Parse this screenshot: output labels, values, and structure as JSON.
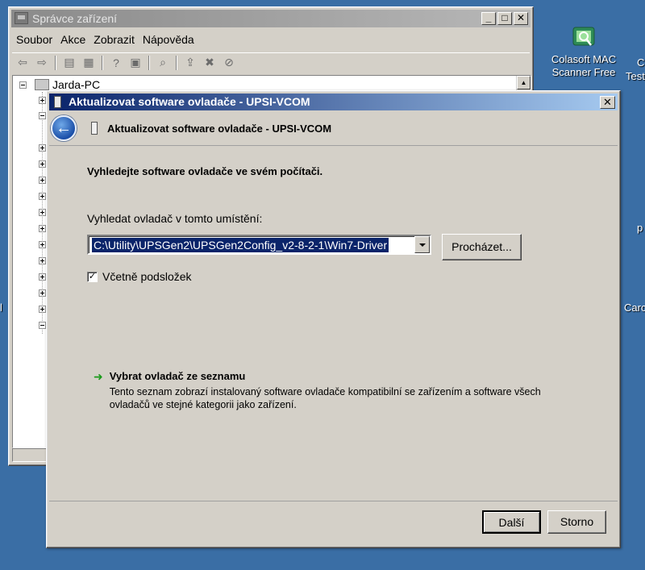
{
  "desktop": {
    "icons": [
      {
        "label_line1": "Colasoft MAC",
        "label_line2": "Scanner Free"
      }
    ],
    "edge_texts": [
      "C",
      "Test",
      "p",
      "Carc",
      "l"
    ]
  },
  "device_manager": {
    "title": "Správce zařízení",
    "menu": [
      "Soubor",
      "Akce",
      "Zobrazit",
      "Nápověda"
    ],
    "tree_root": "Jarda-PC",
    "caption_buttons": {
      "minimize": "_",
      "maximize": "□",
      "close": "✕"
    }
  },
  "wizard": {
    "window_title": "Aktualizovat software ovladače - UPSI-VCOM",
    "header_title": "Aktualizovat software ovladače - UPSI-VCOM",
    "close_label": "✕",
    "heading": "Vyhledejte software ovladače ve svém počítači.",
    "location_label": "Vyhledat ovladač v tomto umístění:",
    "location_value": "C:\\Utility\\UPSGen2\\UPSGen2Config_v2-8-2-1\\Win7-Driver",
    "browse_label": "Procházet...",
    "include_subfolders_label": "Včetně podsložek",
    "include_subfolders_checked": true,
    "check_mark": "✓",
    "link_arrow": "➜",
    "pick_link_title": "Vybrat ovladač ze seznamu",
    "pick_link_desc": "Tento seznam zobrazí instalovaný software ovladače kompatibilní se zařízením a software všech ovladačů ve stejné kategorii jako zařízení.",
    "next_label": "Další",
    "cancel_label": "Storno"
  }
}
